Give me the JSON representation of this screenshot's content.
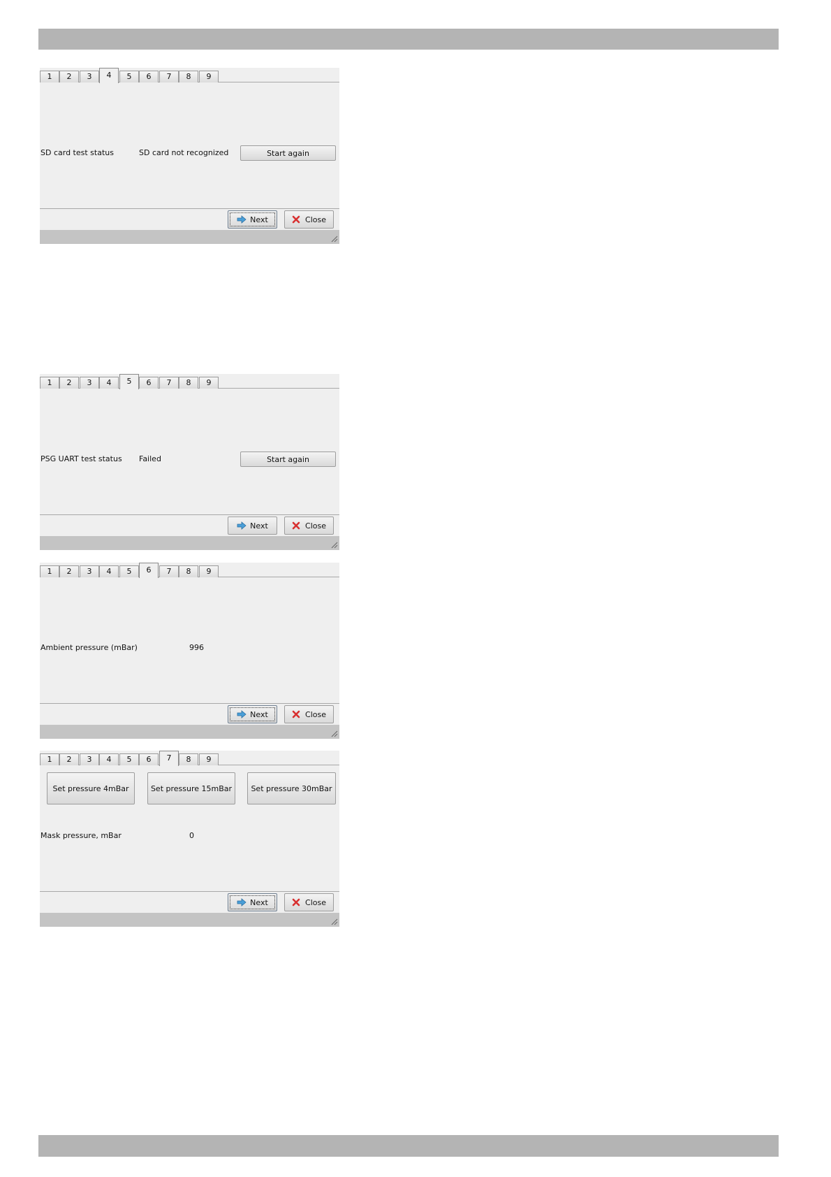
{
  "tabs": [
    "1",
    "2",
    "3",
    "4",
    "5",
    "6",
    "7",
    "8",
    "9"
  ],
  "footer": {
    "next_label": "Next",
    "close_label": "Close"
  },
  "windows": [
    {
      "active_tab": "4",
      "label": "SD card test status",
      "value": "SD card not recognized",
      "action_label": "Start again"
    },
    {
      "active_tab": "5",
      "label": "PSG UART test status",
      "value": "Failed",
      "action_label": "Start again"
    },
    {
      "active_tab": "6",
      "label": "Ambient pressure (mBar)",
      "value": "996"
    },
    {
      "active_tab": "7",
      "pressure_buttons": [
        "Set pressure 4mBar",
        "Set pressure 15mBar",
        "Set pressure 30mBar"
      ],
      "label": "Mask pressure, mBar",
      "value": "0"
    }
  ],
  "colors": {
    "page_bar": "#b4b4b4",
    "window_bg": "#efefef",
    "close_icon": "#d83030",
    "next_icon": "#4a9fd8"
  }
}
